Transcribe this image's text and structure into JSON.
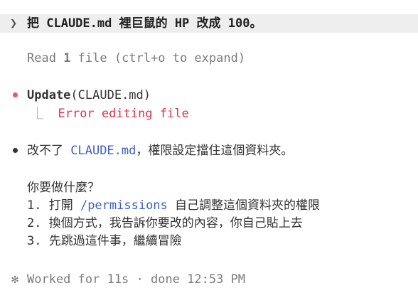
{
  "prompt": {
    "chevron": "❯",
    "text": "把 CLAUDE.md 裡巨鼠的 HP 改成 100。"
  },
  "read": {
    "prefix": "Read ",
    "count": "1",
    "suffix": " file (ctrl+o to expand)"
  },
  "update": {
    "tool": "Update",
    "arg": "(CLAUDE.md)",
    "branch": "⎿",
    "error": "Error editing file"
  },
  "response": {
    "part1": "改不了 ",
    "code": "CLAUDE.md",
    "part2": "，權限設定擋住這個資料夾。",
    "question": "你要做什麼？",
    "option1_pre": "1. 打開 ",
    "option1_code": "/permissions",
    "option1_post": " 自己調整這個資料夾的權限",
    "option2": "2. 換個方式，我告訴你要改的內容，你自己貼上去",
    "option3": "3. 先跳過這件事，繼續冒險"
  },
  "status": {
    "icon": "✻",
    "text": "Worked for 11s · done 12:53 PM"
  },
  "colors": {
    "error": "#d9364b",
    "bullet_error": "#e8566b",
    "code": "#3d5fc8",
    "prompt_bg": "#eeeeee"
  }
}
